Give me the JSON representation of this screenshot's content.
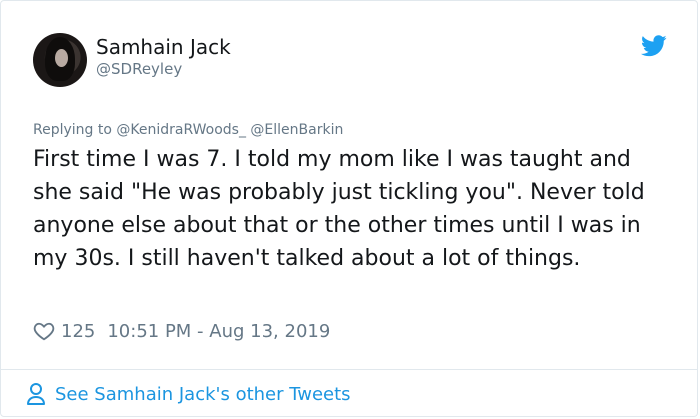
{
  "tweet": {
    "author": {
      "name": "Samhain Jack",
      "handle": "@SDReyley"
    },
    "reply_prefix": "Replying to",
    "reply_mentions": [
      "@KenidraRWoods_",
      "@EllenBarkin"
    ],
    "text": "First time I was 7. I told my mom like I was taught and she said \"He was probably just tickling you\". Never told anyone else about that or the other times until I was in my 30s. I still haven't talked about a lot of things.",
    "likes": "125",
    "timestamp": "10:51 PM - Aug 13, 2019",
    "footer_link": "See Samhain Jack's other Tweets"
  },
  "icons": {
    "brand": "twitter-bird-icon",
    "like": "heart-icon",
    "profile": "person-icon"
  },
  "colors": {
    "accent": "#1da1f2",
    "link": "#1b95e0",
    "secondary_text": "#657786",
    "primary_text": "#14171a",
    "border": "#e1e8ed"
  }
}
